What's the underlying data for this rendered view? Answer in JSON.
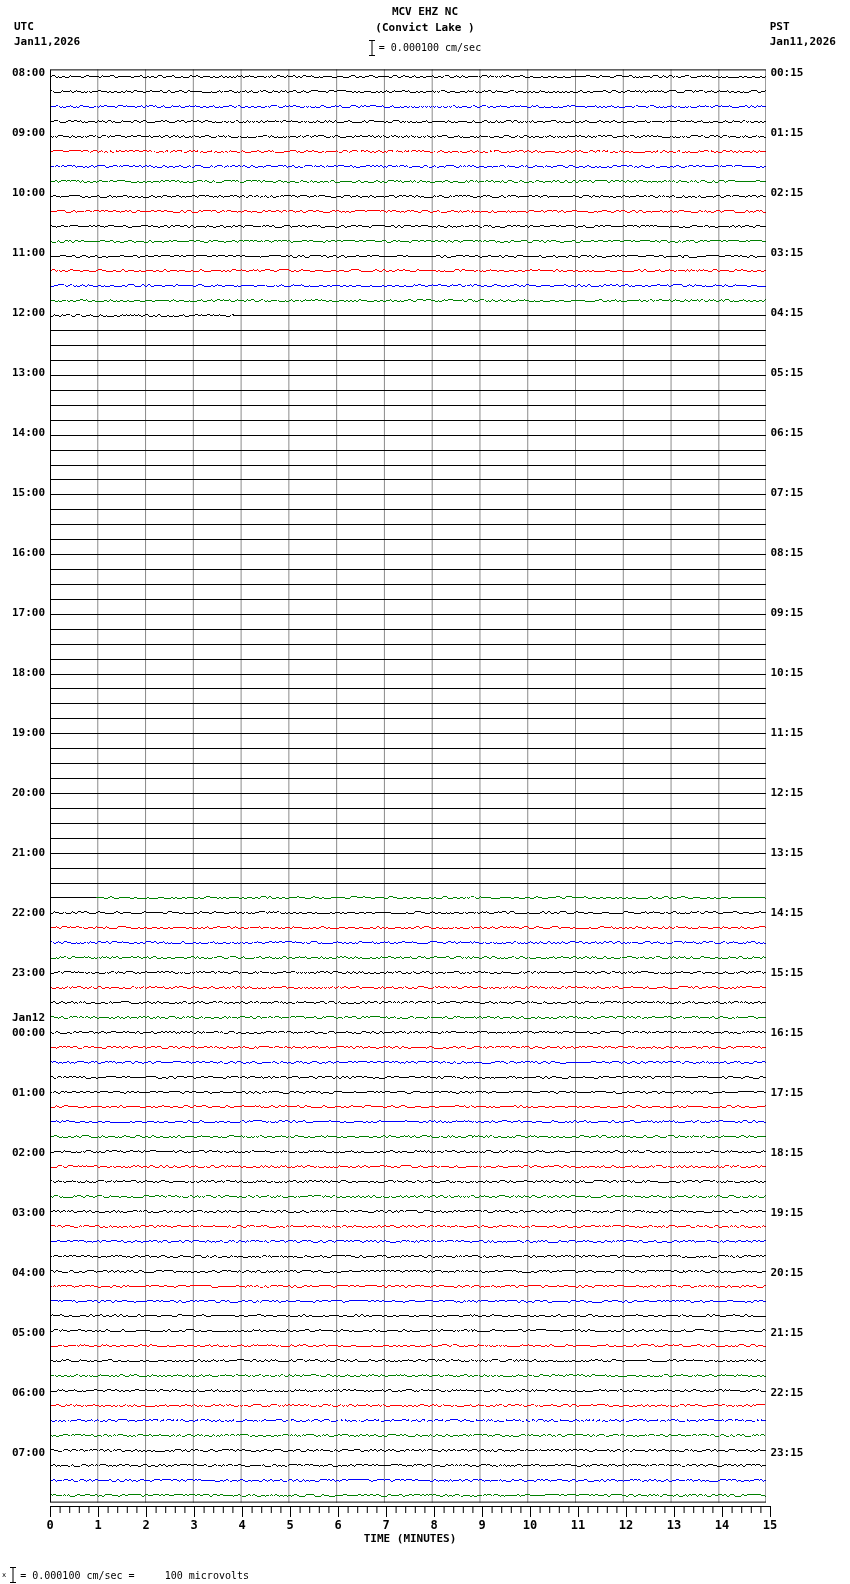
{
  "header": {
    "station": "MCV EHZ NC",
    "location": "(Convict Lake )",
    "scale": "= 0.000100 cm/sec",
    "left_zone": "UTC",
    "left_date": "Jan11,2026",
    "right_zone": "PST",
    "right_date": "Jan11,2026"
  },
  "hours": [
    {
      "utc": "08:00",
      "pst": "00:15"
    },
    {
      "utc": "09:00",
      "pst": "01:15"
    },
    {
      "utc": "10:00",
      "pst": "02:15"
    },
    {
      "utc": "11:00",
      "pst": "03:15"
    },
    {
      "utc": "12:00",
      "pst": "04:15"
    },
    {
      "utc": "13:00",
      "pst": "05:15"
    },
    {
      "utc": "14:00",
      "pst": "06:15"
    },
    {
      "utc": "15:00",
      "pst": "07:15"
    },
    {
      "utc": "16:00",
      "pst": "08:15"
    },
    {
      "utc": "17:00",
      "pst": "09:15"
    },
    {
      "utc": "18:00",
      "pst": "10:15"
    },
    {
      "utc": "19:00",
      "pst": "11:15"
    },
    {
      "utc": "20:00",
      "pst": "12:15"
    },
    {
      "utc": "21:00",
      "pst": "13:15"
    },
    {
      "utc": "22:00",
      "pst": "14:15"
    },
    {
      "utc": "23:00",
      "pst": "15:15"
    },
    {
      "utc": "00:00",
      "pst": "16:15",
      "date": "Jan12"
    },
    {
      "utc": "01:00",
      "pst": "17:15"
    },
    {
      "utc": "02:00",
      "pst": "18:15"
    },
    {
      "utc": "03:00",
      "pst": "19:15"
    },
    {
      "utc": "04:00",
      "pst": "20:15"
    },
    {
      "utc": "05:00",
      "pst": "21:15"
    },
    {
      "utc": "06:00",
      "pst": "22:15"
    },
    {
      "utc": "07:00",
      "pst": "23:15"
    }
  ],
  "rows": [
    {
      "color": "#000000",
      "kind": "trace"
    },
    {
      "color": "#000000",
      "kind": "trace"
    },
    {
      "color": "#0000ff",
      "kind": "trace"
    },
    {
      "color": "#000000",
      "kind": "trace"
    },
    {
      "color": "#000000",
      "kind": "trace"
    },
    {
      "color": "#ff0000",
      "kind": "trace"
    },
    {
      "color": "#0000ff",
      "kind": "trace"
    },
    {
      "color": "#008000",
      "kind": "trace"
    },
    {
      "color": "#000000",
      "kind": "trace"
    },
    {
      "color": "#ff0000",
      "kind": "trace"
    },
    {
      "color": "#000000",
      "kind": "trace"
    },
    {
      "color": "#008000",
      "kind": "trace"
    },
    {
      "color": "#000000",
      "kind": "trace"
    },
    {
      "color": "#ff0000",
      "kind": "trace"
    },
    {
      "color": "#0000ff",
      "kind": "trace"
    },
    {
      "color": "#008000",
      "kind": "trace"
    },
    {
      "color": "#000000",
      "kind": "partial-end"
    },
    {
      "kind": "flat"
    },
    {
      "kind": "flat"
    },
    {
      "kind": "flat"
    },
    {
      "kind": "flat"
    },
    {
      "kind": "flat"
    },
    {
      "kind": "flat"
    },
    {
      "kind": "flat"
    },
    {
      "kind": "flat"
    },
    {
      "kind": "flat"
    },
    {
      "kind": "flat"
    },
    {
      "kind": "flat"
    },
    {
      "kind": "flat"
    },
    {
      "kind": "flat"
    },
    {
      "kind": "flat"
    },
    {
      "kind": "flat"
    },
    {
      "kind": "flat"
    },
    {
      "kind": "flat"
    },
    {
      "kind": "flat"
    },
    {
      "kind": "flat"
    },
    {
      "kind": "flat"
    },
    {
      "kind": "flat"
    },
    {
      "kind": "flat"
    },
    {
      "kind": "flat"
    },
    {
      "kind": "flat"
    },
    {
      "kind": "flat"
    },
    {
      "kind": "flat"
    },
    {
      "kind": "flat"
    },
    {
      "kind": "flat"
    },
    {
      "kind": "flat"
    },
    {
      "kind": "flat"
    },
    {
      "kind": "flat"
    },
    {
      "kind": "flat"
    },
    {
      "kind": "flat"
    },
    {
      "kind": "flat"
    },
    {
      "kind": "flat"
    },
    {
      "kind": "flat"
    },
    {
      "kind": "flat"
    },
    {
      "kind": "flat"
    },
    {
      "color": "#008000",
      "kind": "partial-start"
    },
    {
      "color": "#000000",
      "kind": "trace"
    },
    {
      "color": "#ff0000",
      "kind": "trace"
    },
    {
      "color": "#0000ff",
      "kind": "trace"
    },
    {
      "color": "#008000",
      "kind": "trace"
    },
    {
      "color": "#000000",
      "kind": "trace"
    },
    {
      "color": "#ff0000",
      "kind": "trace"
    },
    {
      "color": "#000000",
      "kind": "trace"
    },
    {
      "color": "#008000",
      "kind": "trace"
    },
    {
      "color": "#000000",
      "kind": "trace"
    },
    {
      "color": "#ff0000",
      "kind": "trace"
    },
    {
      "color": "#0000ff",
      "kind": "trace"
    },
    {
      "color": "#000000",
      "kind": "trace"
    },
    {
      "color": "#000000",
      "kind": "trace"
    },
    {
      "color": "#ff0000",
      "kind": "trace"
    },
    {
      "color": "#0000ff",
      "kind": "trace"
    },
    {
      "color": "#008000",
      "kind": "trace"
    },
    {
      "color": "#000000",
      "kind": "trace"
    },
    {
      "color": "#ff0000",
      "kind": "trace"
    },
    {
      "color": "#000000",
      "kind": "trace"
    },
    {
      "color": "#008000",
      "kind": "trace"
    },
    {
      "color": "#000000",
      "kind": "trace"
    },
    {
      "color": "#ff0000",
      "kind": "trace"
    },
    {
      "color": "#0000ff",
      "kind": "trace"
    },
    {
      "color": "#000000",
      "kind": "trace"
    },
    {
      "color": "#000000",
      "kind": "trace"
    },
    {
      "color": "#ff0000",
      "kind": "trace"
    },
    {
      "color": "#0000ff",
      "kind": "trace"
    },
    {
      "color": "#000000",
      "kind": "trace"
    },
    {
      "color": "#000000",
      "kind": "trace"
    },
    {
      "color": "#ff0000",
      "kind": "trace"
    },
    {
      "color": "#000000",
      "kind": "trace"
    },
    {
      "color": "#008000",
      "kind": "trace"
    },
    {
      "color": "#000000",
      "kind": "trace"
    },
    {
      "color": "#ff0000",
      "kind": "trace"
    },
    {
      "color": "#0000ff",
      "kind": "trace"
    },
    {
      "color": "#008000",
      "kind": "trace"
    },
    {
      "color": "#000000",
      "kind": "trace"
    },
    {
      "color": "#000000",
      "kind": "trace"
    },
    {
      "color": "#0000ff",
      "kind": "trace"
    },
    {
      "color": "#008000",
      "kind": "trace"
    }
  ],
  "x_axis": {
    "ticks": [
      "0",
      "1",
      "2",
      "3",
      "4",
      "5",
      "6",
      "7",
      "8",
      "9",
      "10",
      "11",
      "12",
      "13",
      "14",
      "15"
    ],
    "title": "TIME (MINUTES)"
  },
  "footer": {
    "mark": "x",
    "text": "= 0.000100 cm/sec =     100 microvolts"
  }
}
